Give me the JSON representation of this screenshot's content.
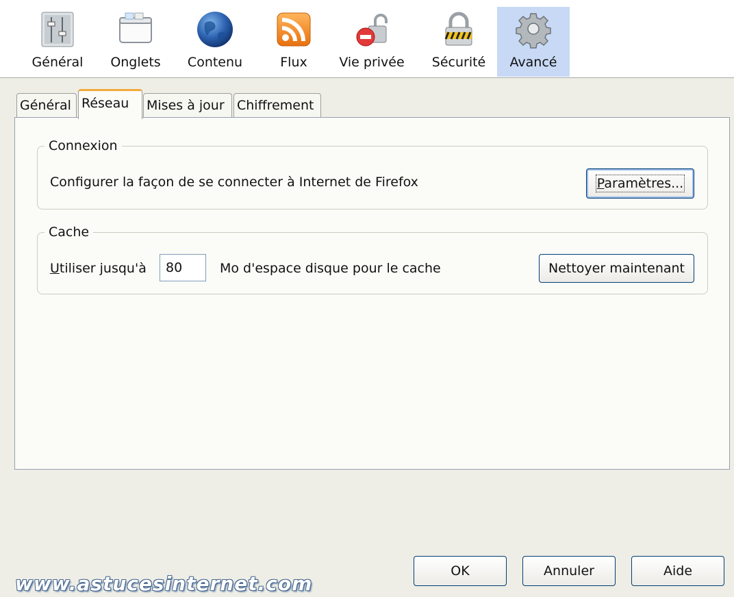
{
  "toolbar": {
    "items": [
      {
        "label": "Général",
        "icon": "general-panel-icon"
      },
      {
        "label": "Onglets",
        "icon": "tabs-window-icon"
      },
      {
        "label": "Contenu",
        "icon": "globe-icon"
      },
      {
        "label": "Flux",
        "icon": "rss-feed-icon"
      },
      {
        "label": "Vie privée",
        "icon": "privacy-lock-icon"
      },
      {
        "label": "Sécurité",
        "icon": "security-padlock-icon"
      },
      {
        "label": "Avancé",
        "icon": "gear-icon"
      }
    ],
    "selected": "Avancé"
  },
  "tabs": [
    {
      "label": "Général"
    },
    {
      "label": "Réseau"
    },
    {
      "label": "Mises à jour"
    },
    {
      "label": "Chiffrement"
    }
  ],
  "selected_tab": "Réseau",
  "connexion": {
    "legend": "Connexion",
    "description": "Configurer la façon de se connecter à Internet de Firefox",
    "settings_button": {
      "accesskey": "P",
      "rest": "aramètres..."
    }
  },
  "cache": {
    "legend": "Cache",
    "label": {
      "accesskey": "U",
      "rest": "tiliser jusqu'à"
    },
    "size_value": "80",
    "suffix": "Mo d'espace disque pour le cache",
    "clear_button": "Nettoyer maintenant"
  },
  "footer": {
    "ok": "OK",
    "cancel": "Annuler",
    "help": "Aide"
  },
  "watermark": "www.astucesinternet.com",
  "colors": {
    "selected_toolbar_bg": "#c7d9f5",
    "active_tab_accent": "#f2a93b",
    "button_border": "#003c74",
    "window_bg": "#eeeee6"
  }
}
